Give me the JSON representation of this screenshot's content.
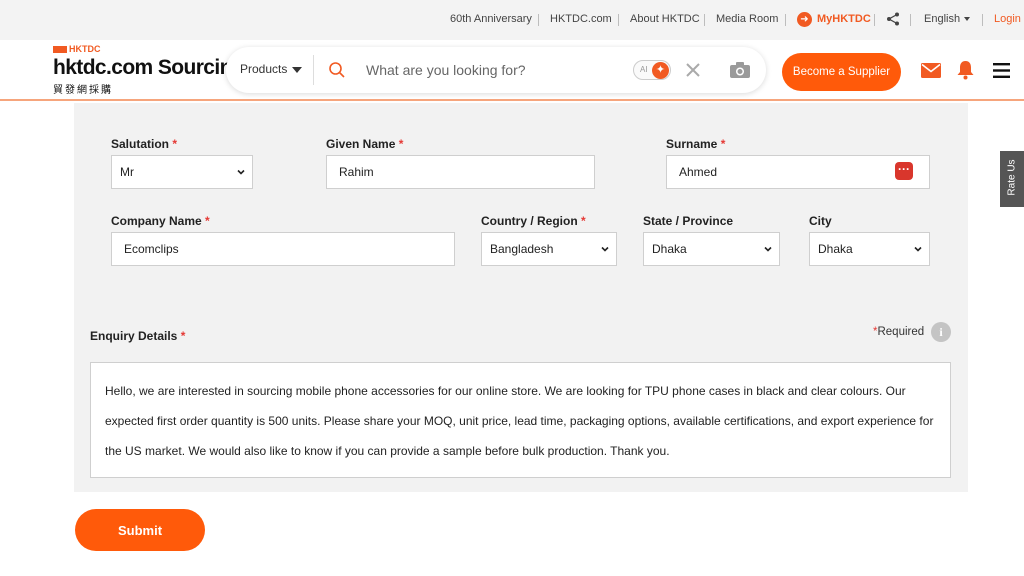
{
  "topbar": {
    "links": [
      "60th Anniversary",
      "HKTDC.com",
      "About HKTDC",
      "Media Room"
    ],
    "my_hktdc": "MyHKTDC",
    "language": "English",
    "login": "Login"
  },
  "header": {
    "logo_brand": "HKTDC",
    "logo_title": "hktdc.com Sourcing",
    "logo_subtitle": "貿發網採購",
    "products_label": "Products",
    "search_placeholder": "What are you looking for?",
    "ai_label": "AI",
    "become_supplier": "Become a Supplier"
  },
  "form": {
    "salutation": {
      "label": "Salutation",
      "value": "Mr"
    },
    "given_name": {
      "label": "Given Name",
      "value": "Rahim"
    },
    "surname": {
      "label": "Surname",
      "value": "Ahmed"
    },
    "company_name": {
      "label": "Company Name",
      "value": "Ecomclips"
    },
    "country_region": {
      "label": "Country / Region",
      "value": "Bangladesh"
    },
    "state_province": {
      "label": "State / Province",
      "value": "Dhaka"
    },
    "city": {
      "label": "City",
      "value": "Dhaka"
    },
    "enquiry": {
      "label": "Enquiry Details",
      "required_note": "Required",
      "text": "Hello, we are interested in sourcing mobile phone accessories for our online store. We are looking for TPU phone cases in black and clear colours. Our expected first order quantity is 500 units. Please share your MOQ, unit price, lead time, packaging options, available certifications, and export experience for the US market. We would also like to know if you can provide a sample before bulk production. Thank you."
    },
    "required_mark": "*",
    "submit_label": "Submit"
  },
  "rate_us": "Rate Us",
  "colors": {
    "accent": "#ff5a0a",
    "brand": "#f15a22",
    "required": "#e53935"
  },
  "icons": [
    "search-icon",
    "close-icon",
    "camera-icon",
    "mail-icon",
    "bell-icon",
    "menu-icon",
    "share-icon",
    "info-icon",
    "chevron-down-icon"
  ]
}
